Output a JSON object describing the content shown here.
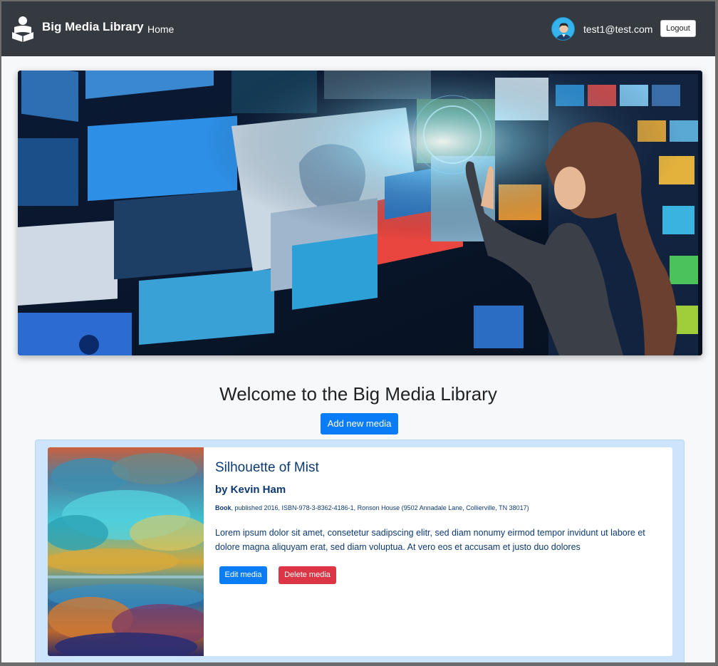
{
  "navbar": {
    "brand": "Big Media Library",
    "home_link": "Home",
    "user_email": "test1@test.com",
    "logout_label": "Logout",
    "brand_icon": "reader-icon",
    "avatar_icon": "user-avatar-icon"
  },
  "hero": {
    "image": "woman-touching-media-screens-wall"
  },
  "main": {
    "heading": "Welcome to the Big Media Library",
    "add_label": "Add new media"
  },
  "media": [
    {
      "title": "Silhouette of Mist",
      "author_line": "by Kevin Ham",
      "type": "Book",
      "details": ", published 2016, ISBN-978-3-8362-4186-1, Ronson House (9502 Annadale Lane, Collierville, TN 38017)",
      "description": "Lorem ipsum dolor sit amet, consetetur sadipscing elitr, sed diam nonumy eirmod tempor invidunt ut labore et dolore magna aliquyam erat, sed diam voluptua. At vero eos et accusam et justo duo dolores",
      "edit_label": "Edit media",
      "delete_label": "Delete media",
      "cover": "abstract-painting-cover"
    }
  ],
  "colors": {
    "navbar": "#343a40",
    "primary": "#0a7cf5",
    "danger": "#dc3545",
    "card_bg": "#cce4fc",
    "text_dark_blue": "#0d3a73"
  }
}
